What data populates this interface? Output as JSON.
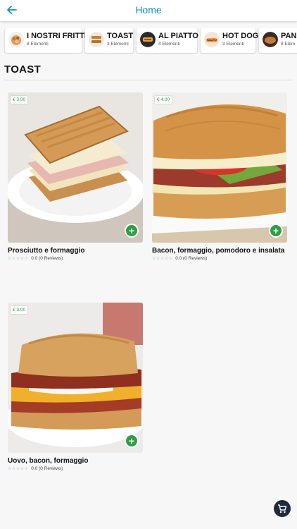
{
  "appbar": {
    "title": "Home",
    "back_icon": "arrow-left-icon"
  },
  "categories": [
    {
      "name": "I NOSTRI FRITTI",
      "count": "8 Elementi"
    },
    {
      "name": "TOAST",
      "count": "3 Elementi"
    },
    {
      "name": "AL PIATTO",
      "count": "4 Elementi"
    },
    {
      "name": "HOT DOG",
      "count": "3 Elementi"
    },
    {
      "name": "PAN",
      "count": "8 Elem"
    }
  ],
  "section": {
    "title": "TOAST"
  },
  "products": [
    {
      "price": "€ 3.00",
      "title": "Prosciutto e formaggio",
      "stars": "☆☆☆☆☆",
      "rating": "0.0 (0 Reviews)"
    },
    {
      "price": "€ 4.00",
      "title": "Bacon, formaggio, pomodoro e insalata",
      "stars": "☆☆☆☆☆",
      "rating": "0.0 (0 Reviews)"
    },
    {
      "price": "€ 3.00",
      "title": "Uovo, bacon, formaggio",
      "stars": "☆☆☆☆☆",
      "rating": "0.0 (0 Reviews)"
    }
  ],
  "add_label": "+",
  "colors": {
    "accent": "#1e88c7",
    "price_green": "#2e9e44",
    "cart_bg": "#1f2a3d"
  },
  "cart_icon": "shopping-cart-icon"
}
